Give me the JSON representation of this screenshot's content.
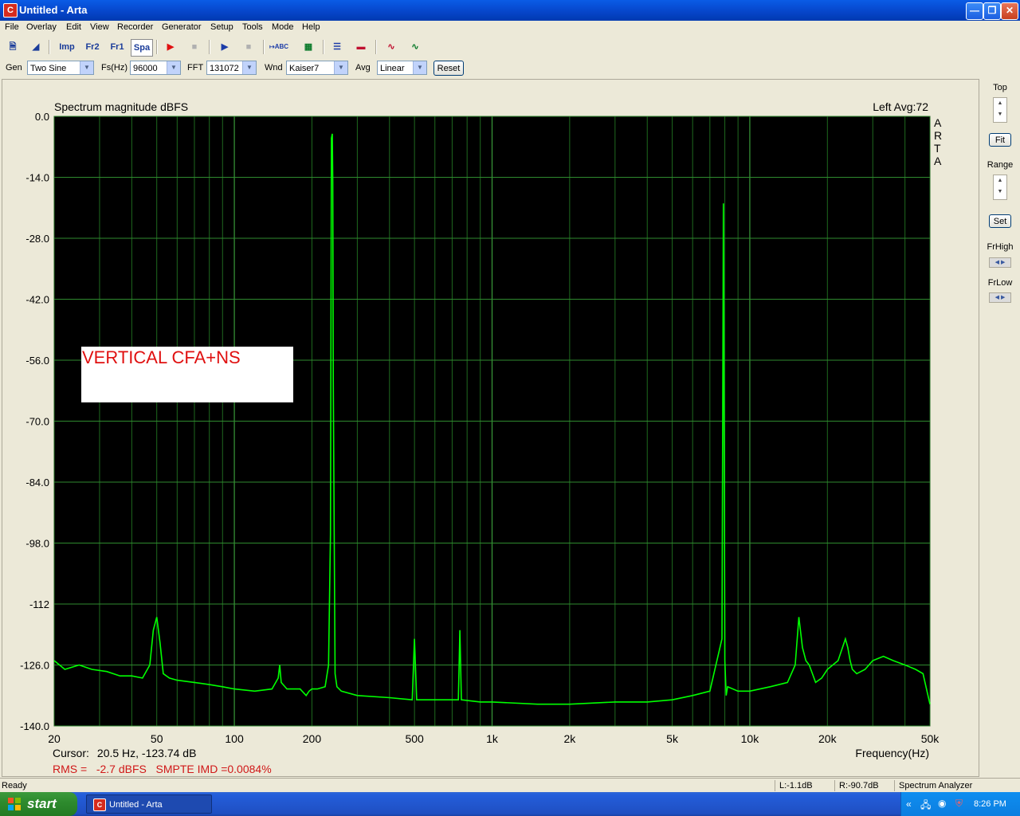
{
  "window": {
    "title": "Untitled - Arta",
    "app_icon_letter": "C"
  },
  "menu": [
    "File",
    "Overlay",
    "Edit",
    "View",
    "Recorder",
    "Generator",
    "Setup",
    "Tools",
    "Mode",
    "Help"
  ],
  "toolbar": {
    "imp": "Imp",
    "fr2": "Fr2",
    "fr1": "Fr1",
    "spa": "Spa"
  },
  "controls": {
    "gen_label": "Gen",
    "gen_value": "Two Sine",
    "fs_label": "Fs(Hz)",
    "fs_value": "96000",
    "fft_label": "FFT",
    "fft_value": "131072",
    "wnd_label": "Wnd",
    "wnd_value": "Kaiser7",
    "avg_label": "Avg",
    "avg_value": "Linear",
    "reset_label": "Reset"
  },
  "side": {
    "top_label": "Top",
    "fit_label": "Fit",
    "range_label": "Range",
    "set_label": "Set",
    "frhigh_label": "FrHigh",
    "frlow_label": "FrLow"
  },
  "plot": {
    "cursor_label": "Cursor:",
    "cursor_value": "20.5 Hz, -123.74 dB",
    "rms_text": "RMS =   -2.7 dBFS   SMPTE IMD =0.0084%",
    "annotation": "VERTICAL CFA+NS",
    "watermark": "ARTA"
  },
  "chart_data": {
    "type": "line",
    "title": "Spectrum magnitude dBFS",
    "subtitle": "Left  Avg:72",
    "xlabel": "Frequency(Hz)",
    "ylabel": "",
    "xscale": "log",
    "xlim": [
      20,
      50000
    ],
    "ylim": [
      -140,
      0
    ],
    "xticks": [
      {
        "v": 20,
        "t": "20"
      },
      {
        "v": 50,
        "t": "50"
      },
      {
        "v": 100,
        "t": "100"
      },
      {
        "v": 200,
        "t": "200"
      },
      {
        "v": 500,
        "t": "500"
      },
      {
        "v": 1000,
        "t": "1k"
      },
      {
        "v": 2000,
        "t": "2k"
      },
      {
        "v": 5000,
        "t": "5k"
      },
      {
        "v": 10000,
        "t": "10k"
      },
      {
        "v": 20000,
        "t": "20k"
      },
      {
        "v": 50000,
        "t": "50k"
      }
    ],
    "yticks": [
      "0.0",
      "-14.0",
      "-28.0",
      "-42.0",
      "-56.0",
      "-70.0",
      "-84.0",
      "-98.0",
      "-112",
      "-126.0",
      "-140.0"
    ],
    "ytick_values": [
      0,
      -14,
      -28,
      -42,
      -56,
      -70,
      -84,
      -98,
      -112,
      -126,
      -140
    ],
    "grid": true,
    "line_color": "#00ff00",
    "background": "#000000",
    "series": [
      {
        "x": [
          20,
          22,
          25,
          28,
          32,
          36,
          40,
          44,
          47,
          48.5,
          50,
          51.5,
          53,
          56,
          60,
          70,
          80,
          90,
          100,
          120,
          140,
          148,
          150,
          152,
          160,
          180,
          190,
          195,
          200,
          210,
          225,
          232,
          236,
          238,
          240,
          241,
          242,
          244,
          246,
          250,
          260,
          300,
          400,
          490,
          500,
          510,
          600,
          740,
          750,
          760,
          900,
          1000,
          1500,
          2000,
          3000,
          4000,
          5000,
          6000,
          7000,
          7800,
          7900,
          8000,
          8100,
          8200,
          9000,
          10000,
          12000,
          14000,
          15000,
          15500,
          16000,
          16500,
          17000,
          17500,
          18000,
          19000,
          20000,
          22000,
          23500,
          24000,
          24500,
          25000,
          26000,
          28000,
          30000,
          33000,
          36000,
          40000,
          44000,
          47000,
          50000
        ],
        "y": [
          -125,
          -127,
          -126,
          -127,
          -127.5,
          -128.5,
          -128.5,
          -129,
          -126,
          -118,
          -115,
          -121,
          -128,
          -129,
          -129.5,
          -130,
          -130.5,
          -131,
          -131.5,
          -132,
          -131.5,
          -129,
          -126,
          -130,
          -131.5,
          -131.5,
          -133,
          -132,
          -131.5,
          -131.5,
          -131,
          -126,
          -96,
          -5,
          -4,
          -15,
          -60,
          -96,
          -128,
          -131,
          -132,
          -133,
          -133.5,
          -134,
          -120,
          -134,
          -134,
          -134,
          -118,
          -134,
          -134.5,
          -134.5,
          -135,
          -135,
          -134.5,
          -134.5,
          -134,
          -133,
          -132,
          -120,
          -20,
          -125,
          -133,
          -131,
          -132,
          -132,
          -131,
          -130,
          -126,
          -115,
          -122,
          -125,
          -126,
          -128,
          -130,
          -129,
          -127,
          -125,
          -120,
          -122,
          -125,
          -127,
          -128,
          -127,
          -125,
          -124,
          -125,
          -126,
          -127,
          -128,
          -135
        ]
      }
    ]
  }
}
